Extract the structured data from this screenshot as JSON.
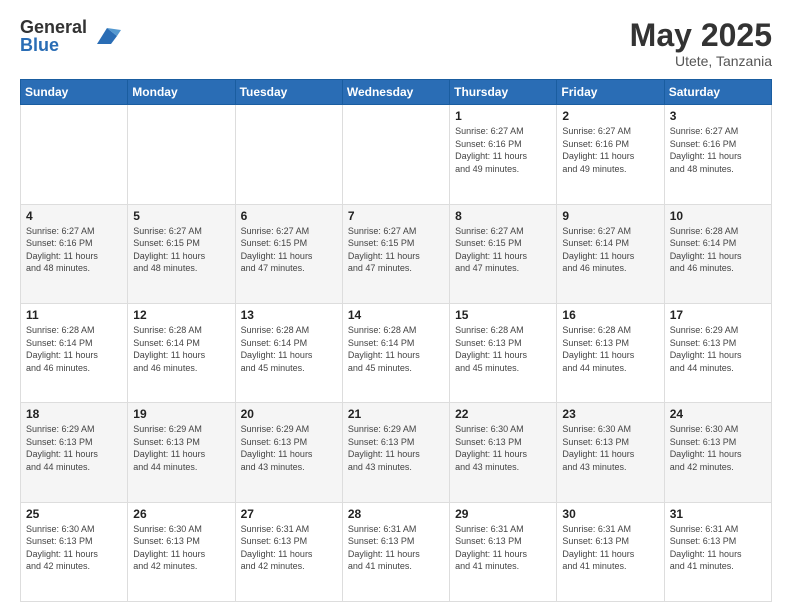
{
  "logo": {
    "general": "General",
    "blue": "Blue"
  },
  "title": {
    "month": "May 2025",
    "location": "Utete, Tanzania"
  },
  "days_header": [
    "Sunday",
    "Monday",
    "Tuesday",
    "Wednesday",
    "Thursday",
    "Friday",
    "Saturday"
  ],
  "weeks": [
    [
      {
        "day": "",
        "info": ""
      },
      {
        "day": "",
        "info": ""
      },
      {
        "day": "",
        "info": ""
      },
      {
        "day": "",
        "info": ""
      },
      {
        "day": "1",
        "info": "Sunrise: 6:27 AM\nSunset: 6:16 PM\nDaylight: 11 hours\nand 49 minutes."
      },
      {
        "day": "2",
        "info": "Sunrise: 6:27 AM\nSunset: 6:16 PM\nDaylight: 11 hours\nand 49 minutes."
      },
      {
        "day": "3",
        "info": "Sunrise: 6:27 AM\nSunset: 6:16 PM\nDaylight: 11 hours\nand 48 minutes."
      }
    ],
    [
      {
        "day": "4",
        "info": "Sunrise: 6:27 AM\nSunset: 6:16 PM\nDaylight: 11 hours\nand 48 minutes."
      },
      {
        "day": "5",
        "info": "Sunrise: 6:27 AM\nSunset: 6:15 PM\nDaylight: 11 hours\nand 48 minutes."
      },
      {
        "day": "6",
        "info": "Sunrise: 6:27 AM\nSunset: 6:15 PM\nDaylight: 11 hours\nand 47 minutes."
      },
      {
        "day": "7",
        "info": "Sunrise: 6:27 AM\nSunset: 6:15 PM\nDaylight: 11 hours\nand 47 minutes."
      },
      {
        "day": "8",
        "info": "Sunrise: 6:27 AM\nSunset: 6:15 PM\nDaylight: 11 hours\nand 47 minutes."
      },
      {
        "day": "9",
        "info": "Sunrise: 6:27 AM\nSunset: 6:14 PM\nDaylight: 11 hours\nand 46 minutes."
      },
      {
        "day": "10",
        "info": "Sunrise: 6:28 AM\nSunset: 6:14 PM\nDaylight: 11 hours\nand 46 minutes."
      }
    ],
    [
      {
        "day": "11",
        "info": "Sunrise: 6:28 AM\nSunset: 6:14 PM\nDaylight: 11 hours\nand 46 minutes."
      },
      {
        "day": "12",
        "info": "Sunrise: 6:28 AM\nSunset: 6:14 PM\nDaylight: 11 hours\nand 46 minutes."
      },
      {
        "day": "13",
        "info": "Sunrise: 6:28 AM\nSunset: 6:14 PM\nDaylight: 11 hours\nand 45 minutes."
      },
      {
        "day": "14",
        "info": "Sunrise: 6:28 AM\nSunset: 6:14 PM\nDaylight: 11 hours\nand 45 minutes."
      },
      {
        "day": "15",
        "info": "Sunrise: 6:28 AM\nSunset: 6:13 PM\nDaylight: 11 hours\nand 45 minutes."
      },
      {
        "day": "16",
        "info": "Sunrise: 6:28 AM\nSunset: 6:13 PM\nDaylight: 11 hours\nand 44 minutes."
      },
      {
        "day": "17",
        "info": "Sunrise: 6:29 AM\nSunset: 6:13 PM\nDaylight: 11 hours\nand 44 minutes."
      }
    ],
    [
      {
        "day": "18",
        "info": "Sunrise: 6:29 AM\nSunset: 6:13 PM\nDaylight: 11 hours\nand 44 minutes."
      },
      {
        "day": "19",
        "info": "Sunrise: 6:29 AM\nSunset: 6:13 PM\nDaylight: 11 hours\nand 44 minutes."
      },
      {
        "day": "20",
        "info": "Sunrise: 6:29 AM\nSunset: 6:13 PM\nDaylight: 11 hours\nand 43 minutes."
      },
      {
        "day": "21",
        "info": "Sunrise: 6:29 AM\nSunset: 6:13 PM\nDaylight: 11 hours\nand 43 minutes."
      },
      {
        "day": "22",
        "info": "Sunrise: 6:30 AM\nSunset: 6:13 PM\nDaylight: 11 hours\nand 43 minutes."
      },
      {
        "day": "23",
        "info": "Sunrise: 6:30 AM\nSunset: 6:13 PM\nDaylight: 11 hours\nand 43 minutes."
      },
      {
        "day": "24",
        "info": "Sunrise: 6:30 AM\nSunset: 6:13 PM\nDaylight: 11 hours\nand 42 minutes."
      }
    ],
    [
      {
        "day": "25",
        "info": "Sunrise: 6:30 AM\nSunset: 6:13 PM\nDaylight: 11 hours\nand 42 minutes."
      },
      {
        "day": "26",
        "info": "Sunrise: 6:30 AM\nSunset: 6:13 PM\nDaylight: 11 hours\nand 42 minutes."
      },
      {
        "day": "27",
        "info": "Sunrise: 6:31 AM\nSunset: 6:13 PM\nDaylight: 11 hours\nand 42 minutes."
      },
      {
        "day": "28",
        "info": "Sunrise: 6:31 AM\nSunset: 6:13 PM\nDaylight: 11 hours\nand 41 minutes."
      },
      {
        "day": "29",
        "info": "Sunrise: 6:31 AM\nSunset: 6:13 PM\nDaylight: 11 hours\nand 41 minutes."
      },
      {
        "day": "30",
        "info": "Sunrise: 6:31 AM\nSunset: 6:13 PM\nDaylight: 11 hours\nand 41 minutes."
      },
      {
        "day": "31",
        "info": "Sunrise: 6:31 AM\nSunset: 6:13 PM\nDaylight: 11 hours\nand 41 minutes."
      }
    ]
  ]
}
